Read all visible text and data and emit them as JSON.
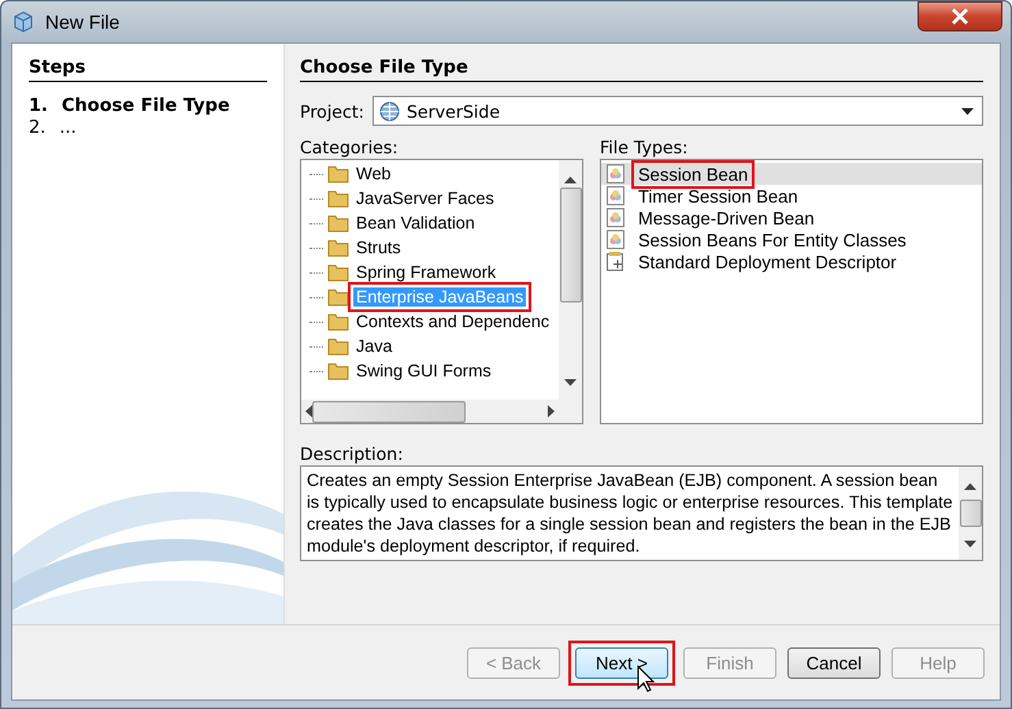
{
  "window": {
    "title": "New File"
  },
  "steps": {
    "title": "Steps",
    "items": [
      {
        "number": "1.",
        "label": "Choose File Type",
        "selected": true
      },
      {
        "number": "2.",
        "label": "...",
        "selected": false
      }
    ]
  },
  "panel": {
    "title": "Choose File Type"
  },
  "project": {
    "label": "Project:",
    "value": "ServerSide"
  },
  "categories": {
    "label": "Categories:",
    "items": [
      {
        "label": "Web",
        "selected": false,
        "annotated": false
      },
      {
        "label": "JavaServer Faces",
        "selected": false,
        "annotated": false
      },
      {
        "label": "Bean Validation",
        "selected": false,
        "annotated": false
      },
      {
        "label": "Struts",
        "selected": false,
        "annotated": false
      },
      {
        "label": "Spring Framework",
        "selected": false,
        "annotated": false
      },
      {
        "label": "Enterprise JavaBeans",
        "selected": true,
        "annotated": true
      },
      {
        "label": "Contexts and Dependenc",
        "selected": false,
        "annotated": false
      },
      {
        "label": "Java",
        "selected": false,
        "annotated": false
      },
      {
        "label": "Swing GUI Forms",
        "selected": false,
        "annotated": false
      }
    ]
  },
  "file_types": {
    "label": "File Types:",
    "items": [
      {
        "label": "Session Bean",
        "kind": "bean",
        "selected": true,
        "annotated": true
      },
      {
        "label": "Timer Session Bean",
        "kind": "bean",
        "selected": false,
        "annotated": false
      },
      {
        "label": "Message-Driven Bean",
        "kind": "bean",
        "selected": false,
        "annotated": false
      },
      {
        "label": "Session Beans For Entity Classes",
        "kind": "bean",
        "selected": false,
        "annotated": false
      },
      {
        "label": "Standard Deployment Descriptor",
        "kind": "descriptor",
        "selected": false,
        "annotated": false
      }
    ]
  },
  "description": {
    "label": "Description:",
    "text": "Creates an empty Session Enterprise JavaBean (EJB) component. A session bean is typically used to encapsulate business logic or enterprise resources. This template creates the Java classes for a single session bean and registers the bean in the EJB module's deployment descriptor, if required."
  },
  "buttons": [
    {
      "label": "< Back",
      "disabled": true,
      "default": false,
      "annotated": false
    },
    {
      "label": "Next >",
      "disabled": false,
      "default": true,
      "annotated": true
    },
    {
      "label": "Finish",
      "disabled": true,
      "default": false,
      "annotated": false
    },
    {
      "label": "Cancel",
      "disabled": false,
      "default": false,
      "annotated": false
    },
    {
      "label": "Help",
      "disabled": true,
      "default": false,
      "annotated": false
    }
  ]
}
